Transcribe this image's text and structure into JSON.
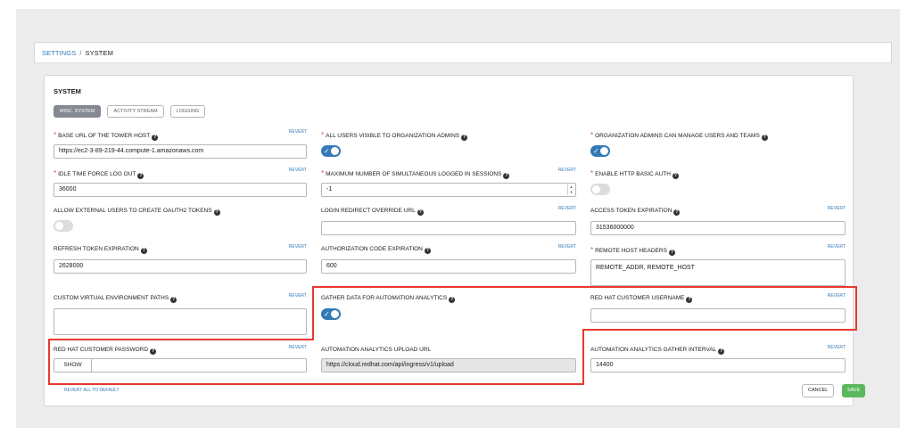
{
  "breadcrumb": {
    "link": "SETTINGS",
    "separator": "/",
    "current": "SYSTEM"
  },
  "card": {
    "title": "SYSTEM",
    "tabs": [
      "MISC. SYSTEM",
      "ACTIVITY STREAM",
      "LOGGING"
    ]
  },
  "help_glyph": "?",
  "revert_label": "REVERT",
  "fields": {
    "base_url": {
      "label": "BASE URL OF THE TOWER HOST",
      "value": "https://ec2-3-89-219-44.compute-1.amazonaws.com"
    },
    "all_users_visible": {
      "label": "ALL USERS VISIBLE TO ORGANIZATION ADMINS",
      "on": true
    },
    "org_admins_manage": {
      "label": "ORGANIZATION ADMINS CAN MANAGE USERS AND TEAMS",
      "on": true
    },
    "idle_logout": {
      "label": "IDLE TIME FORCE LOG OUT",
      "value": "36000"
    },
    "max_sessions": {
      "label": "MAXIMUM NUMBER OF SIMULTANEOUS LOGGED IN SESSIONS",
      "value": "-1"
    },
    "basic_auth": {
      "label": "ENABLE HTTP BASIC AUTH",
      "on": false
    },
    "external_oauth": {
      "label": "ALLOW EXTERNAL USERS TO CREATE OAUTH2 TOKENS",
      "on": false
    },
    "login_redirect": {
      "label": "LOGIN REDIRECT OVERRIDE URL",
      "value": ""
    },
    "access_token_exp": {
      "label": "ACCESS TOKEN EXPIRATION",
      "value": "31536000000"
    },
    "refresh_token_exp": {
      "label": "REFRESH TOKEN EXPIRATION",
      "value": "2628000"
    },
    "auth_code_exp": {
      "label": "AUTHORIZATION CODE EXPIRATION",
      "value": "600"
    },
    "remote_host_headers": {
      "label": "REMOTE HOST HEADERS",
      "value": "REMOTE_ADDR, REMOTE_HOST"
    },
    "custom_venv_paths": {
      "label": "CUSTOM VIRTUAL ENVIRONMENT PATHS",
      "value": ""
    },
    "gather_analytics": {
      "label": "GATHER DATA FOR AUTOMATION ANALYTICS",
      "on": true
    },
    "rh_username": {
      "label": "RED HAT CUSTOMER USERNAME",
      "value": ""
    },
    "rh_password": {
      "label": "RED HAT CUSTOMER PASSWORD",
      "show_label": "SHOW",
      "value": ""
    },
    "upload_url": {
      "label": "AUTOMATION ANALYTICS UPLOAD URL",
      "value": "https://cloud.redhat.com/api/ingress/v1/upload"
    },
    "gather_interval": {
      "label": "AUTOMATION ANALYTICS GATHER INTERVAL",
      "value": "14400"
    }
  },
  "footer": {
    "revert_all": "REVERT ALL TO DEFAULT",
    "cancel": "CANCEL",
    "save": "SAVE"
  },
  "colors": {
    "primary": "#337ab7",
    "save": "#5cb85c",
    "required": "#d9534f",
    "highlight": "#e8392f"
  }
}
